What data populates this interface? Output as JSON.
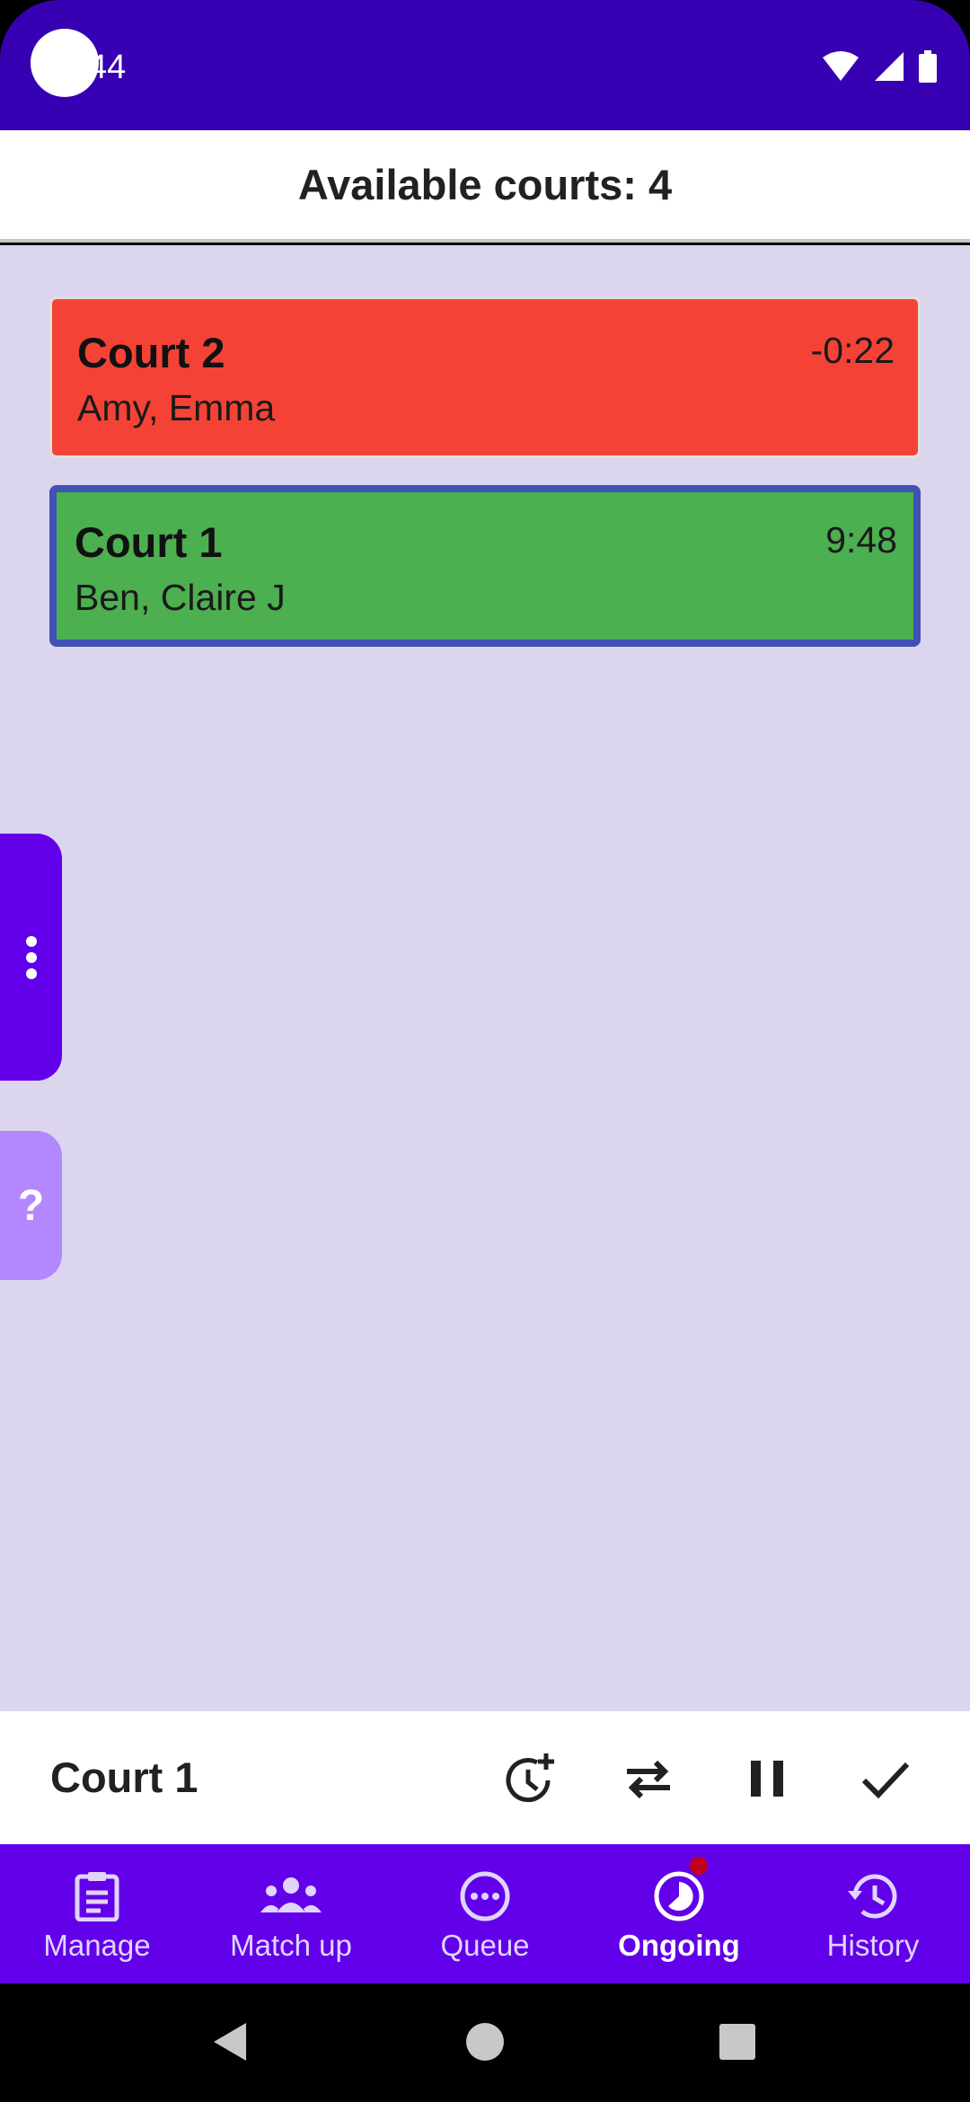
{
  "status_bar": {
    "time": "44",
    "icons": [
      "wifi-icon",
      "signal-icon",
      "battery-icon"
    ]
  },
  "header": {
    "title": "Available courts: 4"
  },
  "courts": [
    {
      "name": "Court 2",
      "players": "Amy, Emma",
      "time": "-0:22",
      "color": "#f44336",
      "selected": false
    },
    {
      "name": "Court 1",
      "players": "Ben, Claire J",
      "time": "9:48",
      "color": "#4caf50",
      "selected": true
    }
  ],
  "side_tabs": {
    "menu_icon": "more-vertical-icon",
    "help_label": "?"
  },
  "action_bar": {
    "selected_court": "Court 1",
    "actions": [
      "add-time-icon",
      "swap-icon",
      "pause-icon",
      "check-icon"
    ]
  },
  "bottom_nav": {
    "items": [
      {
        "label": "Manage",
        "icon": "clipboard-icon",
        "active": false
      },
      {
        "label": "Match up",
        "icon": "group-icon",
        "active": false
      },
      {
        "label": "Queue",
        "icon": "more-horizontal-circle-icon",
        "active": false
      },
      {
        "label": "Ongoing",
        "icon": "timelapse-icon",
        "active": true,
        "badge": true
      },
      {
        "label": "History",
        "icon": "history-icon",
        "active": false
      }
    ]
  },
  "colors": {
    "status_bar": "#3700b3",
    "primary": "#6200ea",
    "background": "#dcd5ee",
    "selected_border": "#3f51b5",
    "help_tab": "#b388ff",
    "badge": "#c2001b"
  }
}
